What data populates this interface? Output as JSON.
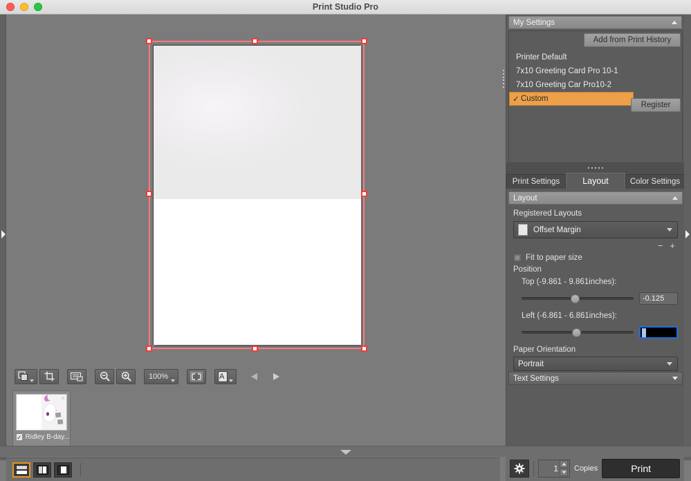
{
  "window": {
    "title": "Print Studio Pro",
    "controls": {
      "close": "close",
      "minimize": "minimize",
      "zoom": "zoom"
    }
  },
  "my_settings": {
    "header": "My Settings",
    "add_from_history_label": "Add from Print History",
    "register_label": "Register",
    "items": [
      {
        "label": "Printer Default",
        "selected": false
      },
      {
        "label": "7x10 Greeting Card Pro 10-1",
        "selected": false
      },
      {
        "label": "7x10 Greeting Car Pro10-2",
        "selected": false
      },
      {
        "label": "Custom",
        "selected": true,
        "check": "✓"
      }
    ]
  },
  "tabs": [
    {
      "label": "Print Settings",
      "active": false
    },
    {
      "label": "Layout",
      "active": true
    },
    {
      "label": "Color Settings",
      "active": false
    }
  ],
  "layout": {
    "section_header": "Layout",
    "registered_layouts_label": "Registered Layouts",
    "registered_layouts_value": "Offset Margin",
    "minus_label": "−",
    "plus_label": "+",
    "fit_to_paper_label": "Fit to paper size",
    "fit_to_paper_checked": false,
    "position_label": "Position",
    "top": {
      "label": "Top (-9.861 - 9.861inches):",
      "value": "-0.125",
      "min": -9.861,
      "max": 9.861,
      "thumb_percent": 49.4
    },
    "left": {
      "label": "Left (-6.861 - 6.861inches):",
      "value": "",
      "min": -6.861,
      "max": 6.861,
      "thumb_percent": 49.7,
      "focused": true
    },
    "paper_orientation_label": "Paper Orientation",
    "paper_orientation_value": "Portrait"
  },
  "text_settings": {
    "header": "Text Settings"
  },
  "toolbar": {
    "buttons": [
      {
        "name": "select-tool",
        "icon": "layers-icon",
        "has_dropdown": true
      },
      {
        "name": "crop-tool",
        "icon": "crop-icon",
        "has_dropdown": false
      },
      {
        "name": "page-setup",
        "icon": "page-icon",
        "has_dropdown": false
      },
      {
        "name": "zoom-out",
        "icon": "zoom-out-icon",
        "has_dropdown": false
      },
      {
        "name": "zoom-in",
        "icon": "zoom-in-icon",
        "has_dropdown": false
      }
    ],
    "zoom_level": "100%",
    "fit_window_icon": "fit-to-window-icon",
    "text_tool_icon": "text-tool-icon",
    "prev_icon": "previous-page-icon",
    "next_icon": "next-page-icon"
  },
  "thumbnail": {
    "label": "Ridley B-day...",
    "checked": true,
    "check_glyph": "✓"
  },
  "view_modes": [
    {
      "name": "view-single",
      "selected": true
    },
    {
      "name": "view-split-left",
      "selected": false
    },
    {
      "name": "view-split-right",
      "selected": false
    }
  ],
  "print_bar": {
    "settings_icon": "gear-icon",
    "copies_value": "1",
    "copies_label": "Copies",
    "print_label": "Print"
  },
  "colors": {
    "accent_orange": "#eda049",
    "selection_red": "#f03b3b",
    "focus_blue": "#1d6ee0",
    "panel_bg": "#5c5c5c",
    "canvas_bg": "#7b7b7b"
  }
}
